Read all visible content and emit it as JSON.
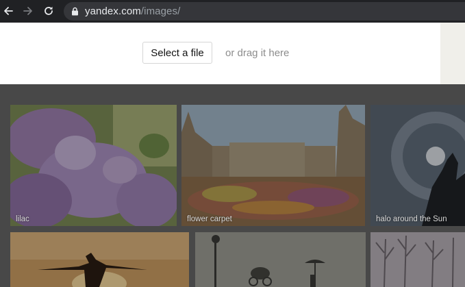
{
  "browser": {
    "url_host": "yandex.com",
    "url_path": "/images/",
    "nav_icons": [
      "back-arrow-icon",
      "forward-arrow-icon",
      "reload-icon"
    ],
    "secure_icon": "lock-icon"
  },
  "upload": {
    "select_button": "Select a file",
    "drag_hint": "or drag it here"
  },
  "gallery": {
    "tiles": [
      {
        "label": "lilac"
      },
      {
        "label": "flower carpet"
      },
      {
        "label": "halo around the Sun"
      },
      {
        "label": ""
      },
      {
        "label": ""
      },
      {
        "label": ""
      }
    ]
  },
  "colors": {
    "toolbar_bg": "#202124",
    "omnibox_bg": "#35363a",
    "overlay": "#484848"
  }
}
